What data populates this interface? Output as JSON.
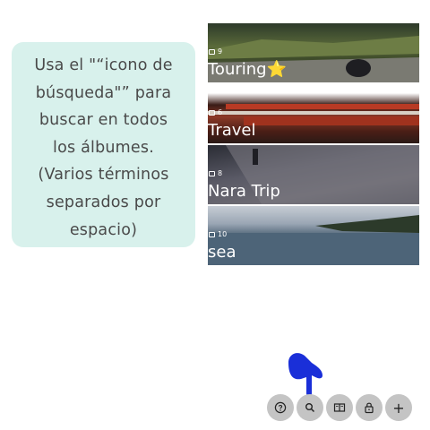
{
  "tooltip": {
    "text_lines": [
      "Usa el \"“icono de",
      "búsqueda\"” para",
      "buscar en todos",
      "los álbumes.",
      "(Varios términos",
      "separados por",
      "espacio)"
    ]
  },
  "albums": [
    {
      "title": "Touring⭐",
      "count": "9"
    },
    {
      "title": "Travel",
      "count": "6"
    },
    {
      "title": "Nara Trip",
      "count": "8"
    },
    {
      "title": "sea",
      "count": "10"
    }
  ],
  "toolbar": {
    "help_icon": "help-circle-icon",
    "search_icon": "search-icon",
    "book_icon": "open-book-icon",
    "lock_icon": "lock-icon",
    "add_icon": "plus-icon",
    "add_label": "+"
  },
  "colors": {
    "tooltip_bg": "#d8f1ec",
    "button_bg": "#c4c4c4",
    "pointer": "#1a2fd8"
  }
}
